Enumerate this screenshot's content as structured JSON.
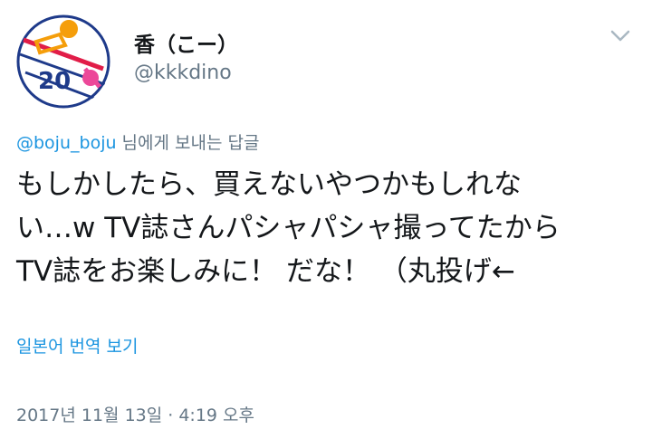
{
  "user": {
    "display_name": "香（こー）",
    "handle": "@kkkdino",
    "avatar_label": "20"
  },
  "reply": {
    "mention": "@boju_boju",
    "suffix": " 님에게 보내는 답글"
  },
  "tweet": {
    "text": "もしかしたら、買えないやつかもしれな\nい…w TV誌さんパシャパシャ撮ってたから\nTV誌をお楽しみに！ だな！ （丸投げ←"
  },
  "translate_label": "일본어 번역 보기",
  "timestamp": "2017년 11월 13일 · 4:19 오후",
  "colors": {
    "link": "#1b95e0",
    "secondary": "#657786",
    "text": "#14171a"
  },
  "icons": {
    "menu": "chevron-down-icon"
  }
}
